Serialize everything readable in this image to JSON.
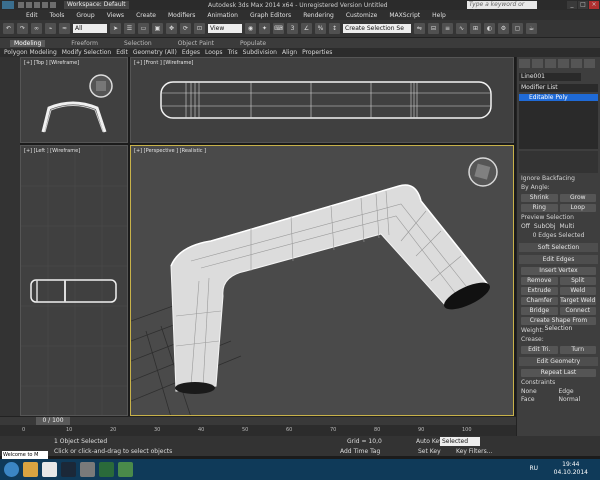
{
  "titlebar": {
    "workspace": "Workspace: Default",
    "title": "Autodesk 3ds Max  2014 x64  -  Unregistered Version    Untitled",
    "search_placeholder": "Type a keyword or phrase"
  },
  "menu": [
    "Edit",
    "Tools",
    "Group",
    "Views",
    "Create",
    "Modifiers",
    "Animation",
    "Graph Editors",
    "Rendering",
    "Customize",
    "MAXScript",
    "Help"
  ],
  "toolbar": {
    "filter": "All",
    "coord": "View",
    "selection_set": "Create Selection Se"
  },
  "ribbon_tabs": [
    "Modeling",
    "Freeform",
    "Selection",
    "Object Paint",
    "Populate"
  ],
  "ribbon_items": [
    "Polygon Modeling",
    "Modify Selection",
    "Edit",
    "Geometry (All)",
    "Edges",
    "Loops",
    "Tris",
    "Subdivision",
    "Align",
    "Properties"
  ],
  "viewports": {
    "top": "[+] [Top ] [Wireframe]",
    "front": "[+] [Front ] [Wireframe]",
    "left": "[+] [Left ] [Wireframe]",
    "perspective": "[+] [Perspective ] [Realistic ]"
  },
  "command_panel": {
    "object_name": "Line001",
    "modifier_list": "Modifier List",
    "stack_item": "Editable Poly",
    "ignore_backfacing": "Ignore Backfacing",
    "by_angle": "By Angle:",
    "shrink": "Shrink",
    "grow": "Grow",
    "ring": "Ring",
    "loop": "Loop",
    "preview_selection": "Preview Selection",
    "off": "Off",
    "subobj": "SubObj",
    "multi": "Multi",
    "edges_selected": "0 Edges Selected",
    "soft_selection": "Soft Selection",
    "edit_edges": "Edit Edges",
    "insert_vertex": "Insert Vertex",
    "remove": "Remove",
    "split": "Split",
    "extrude": "Extrude",
    "weld": "Weld",
    "chamfer": "Chamfer",
    "target_weld": "Target Weld",
    "bridge": "Bridge",
    "connect": "Connect",
    "create_shape": "Create Shape From Selection",
    "weight": "Weight:",
    "crease": "Crease:",
    "edit_tri": "Edit Tri.",
    "turn": "Turn",
    "edit_geometry": "Edit Geometry",
    "repeat_last": "Repeat Last",
    "constraints": "Constraints",
    "none": "None",
    "edge": "Edge",
    "face": "Face",
    "normal": "Normal"
  },
  "timeline": {
    "frame": "0 / 100",
    "ticks": [
      "0",
      "10",
      "20",
      "30",
      "40",
      "50",
      "60",
      "70",
      "80",
      "90",
      "100"
    ]
  },
  "status": {
    "selected": "1 Object Selected",
    "prompt": "Click or click-and-drag to select objects",
    "grid": "Grid = 10,0",
    "auto_key": "Auto Key",
    "selected_dd": "Selected",
    "set_key": "Set Key",
    "key_filters": "Key Filters...",
    "add_time_tag": "Add Time Tag",
    "listener": "Welcome to M"
  },
  "taskbar": {
    "lang": "RU",
    "time": "19:44",
    "date": "04.10.2014"
  },
  "colors": {
    "accent": "#1f6ad6",
    "viewport_border_active": "#c8b24a"
  }
}
